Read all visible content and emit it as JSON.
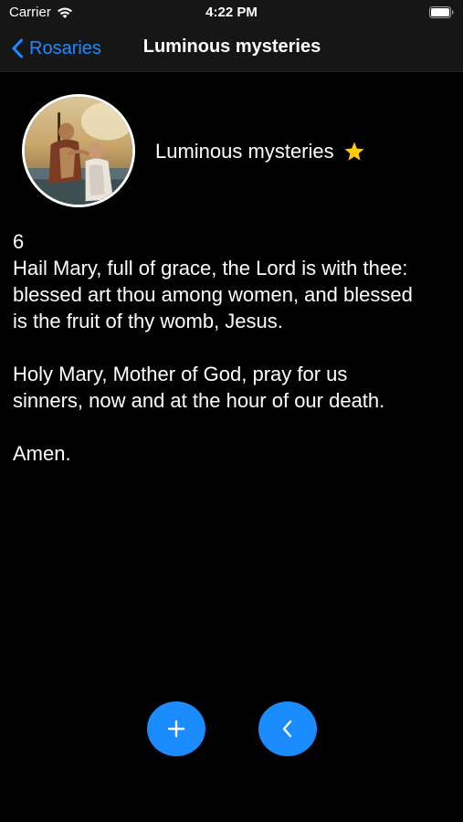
{
  "status_bar": {
    "carrier": "Carrier",
    "time": "4:22 PM",
    "icons": [
      "wifi-icon",
      "battery-icon"
    ]
  },
  "nav": {
    "back_label": "Rosaries",
    "title": "Luminous mysteries",
    "accent_color": "#1a8cff"
  },
  "header": {
    "title": "Luminous mysteries",
    "favorite_icon": "star-icon",
    "image": "baptism-painting"
  },
  "prayer": {
    "count": "6",
    "lines": [
      "Hail Mary, full of grace, the Lord is with thee:",
      "blessed art thou among women, and blessed",
      "is the fruit of thy womb, Jesus.",
      "",
      "Holy Mary, Mother of God, pray for us",
      "sinners, now and at the hour of our death.",
      "",
      "Amen."
    ]
  },
  "actions": {
    "add_icon": "plus-icon",
    "previous_icon": "chevron-left-icon",
    "button_color": "#1a8cff"
  }
}
